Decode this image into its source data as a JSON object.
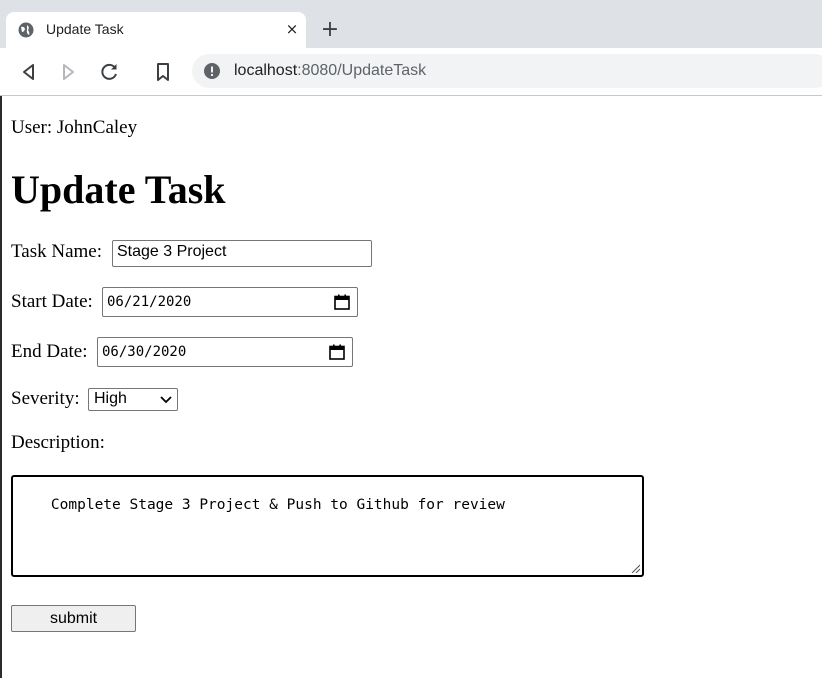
{
  "browser": {
    "tab_title": "Update Task",
    "tab_close": "×",
    "new_tab": "+",
    "url_host": "localhost",
    "url_path": ":8080/UpdateTask"
  },
  "page": {
    "user_label": "User: JohnCaley",
    "heading": "Update Task",
    "task_name_label": "Task Name:",
    "task_name_value": "Stage 3 Project",
    "start_date_label": "Start Date:",
    "start_date_value": "06/21/2020",
    "end_date_label": "End Date:",
    "end_date_value": "06/30/2020",
    "severity_label": "Severity:",
    "severity_value": "High",
    "description_label": "Description:",
    "description_value": "Complete Stage 3 Project & Push to Github for review",
    "submit_label": "submit"
  },
  "icons": {
    "favicon": "globe-icon",
    "back": "back-arrow-icon",
    "forward": "forward-arrow-icon",
    "reload": "reload-icon",
    "bookmark": "bookmark-icon",
    "site_info": "info-icon",
    "calendar": "calendar-icon"
  }
}
